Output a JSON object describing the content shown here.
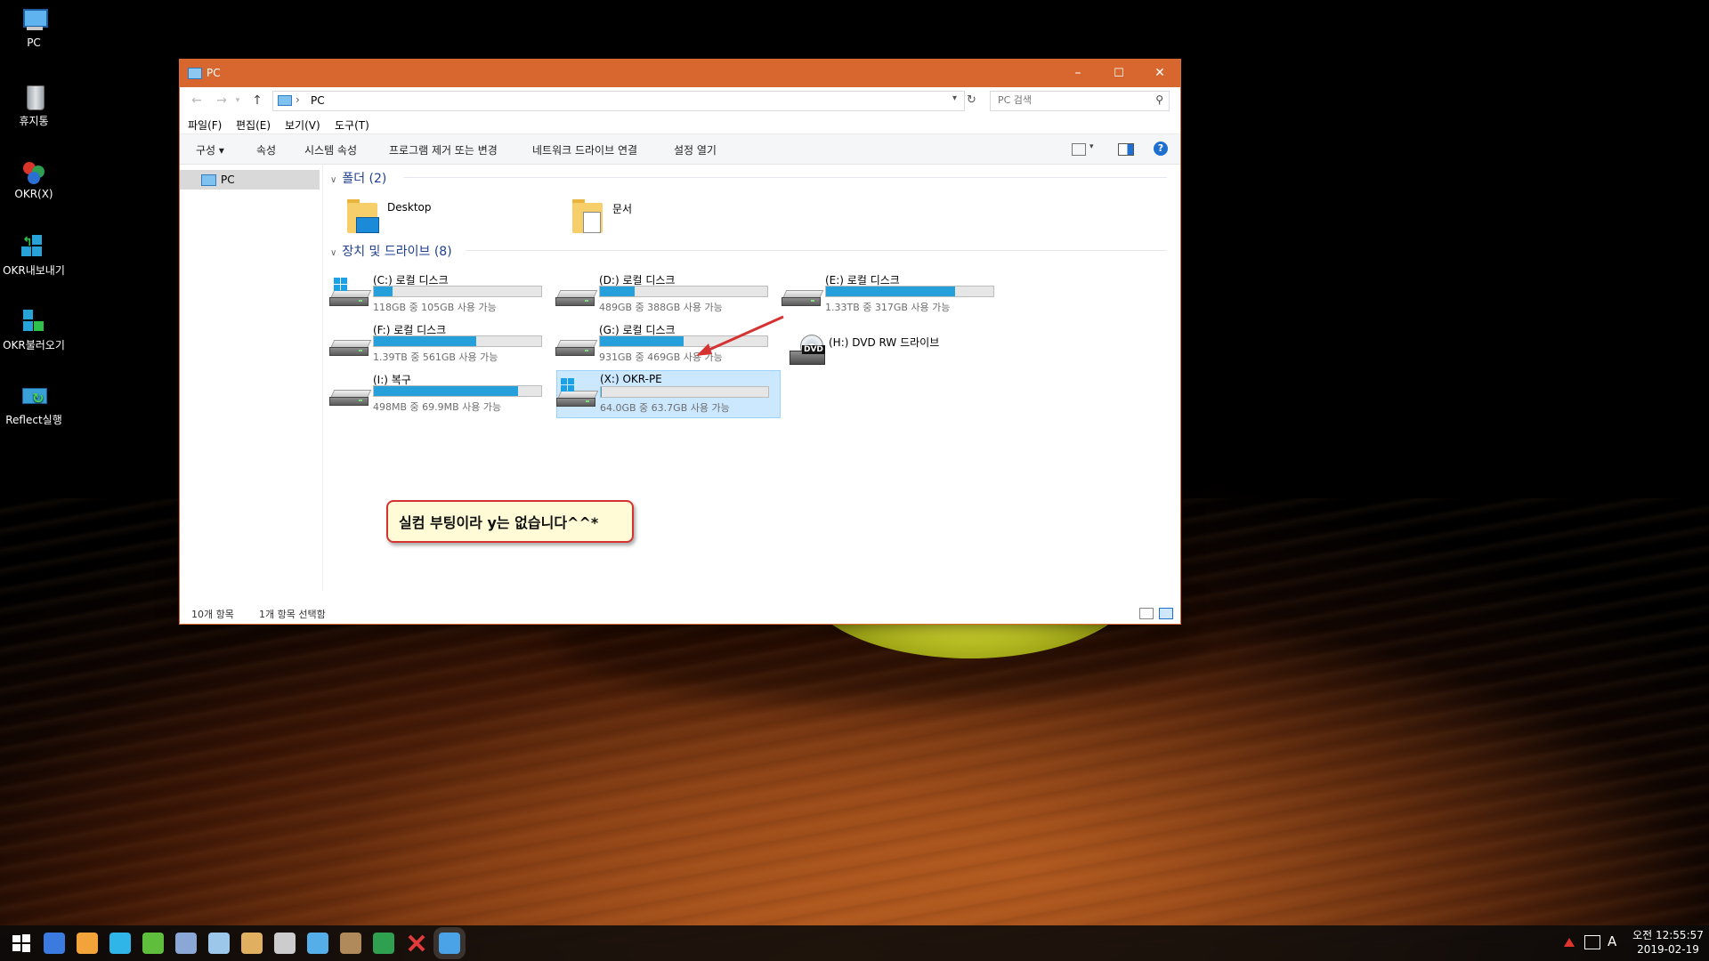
{
  "desktop": {
    "icons": [
      {
        "label": "PC",
        "icon": "pc-icon"
      },
      {
        "label": "휴지통",
        "icon": "recycle-bin-icon"
      },
      {
        "label": "OKR(X)",
        "icon": "okr-app-icon"
      },
      {
        "label": "OKR내보내기",
        "icon": "okr-export-icon"
      },
      {
        "label": "OKR불러오기",
        "icon": "okr-import-icon"
      },
      {
        "label": "Reflect실행",
        "icon": "reflect-icon"
      }
    ]
  },
  "window": {
    "title": "PC",
    "controls": {
      "minimize": "–",
      "maximize": "☐",
      "close": "✕"
    },
    "address": {
      "crumb": "PC",
      "separator": "›"
    },
    "search": {
      "placeholder": "PC 검색"
    },
    "menu": [
      "파일(F)",
      "편집(E)",
      "보기(V)",
      "도구(T)"
    ],
    "commands": [
      "구성 ▾",
      "속성",
      "시스템 속성",
      "프로그램 제거 또는 변경",
      "네트워크 드라이브 연결",
      "설정 열기"
    ],
    "help": "?",
    "nav": {
      "selected": "PC"
    },
    "groups": {
      "folders": {
        "title": "폴더 (2)",
        "items": [
          "Desktop",
          "문서"
        ]
      },
      "drives": {
        "title": "장치 및 드라이브 (8)"
      }
    },
    "drives": [
      {
        "name": "(C:) 로컬 디스크",
        "free": "118GB 중 105GB 사용 가능",
        "used": 0.11,
        "windows": true,
        "selected": false
      },
      {
        "name": "(D:) 로컬 디스크",
        "free": "489GB 중 388GB 사용 가능",
        "used": 0.21,
        "windows": false,
        "selected": false
      },
      {
        "name": "(E:) 로컬 디스크",
        "free": "1.33TB 중 317GB 사용 가능",
        "used": 0.77,
        "windows": false,
        "selected": false
      },
      {
        "name": "(F:) 로컬 디스크",
        "free": "1.39TB 중 561GB 사용 가능",
        "used": 0.61,
        "windows": false,
        "selected": false
      },
      {
        "name": "(G:) 로컬 디스크",
        "free": "931GB 중 469GB 사용 가능",
        "used": 0.5,
        "windows": false,
        "selected": false
      },
      {
        "name": "(I:) 복구",
        "free": "498MB 중 69.9MB 사용 가능",
        "used": 0.86,
        "windows": false,
        "selected": false
      },
      {
        "name": "(X:) OKR-PE",
        "free": "64.0GB 중 63.7GB 사용 가능",
        "used": 0.005,
        "windows": true,
        "selected": true
      }
    ],
    "dvd": {
      "name": "(H:) DVD RW 드라이브",
      "badge": "DVD"
    },
    "status": {
      "count": "10개 항목",
      "selected": "1개 항목 선택함"
    }
  },
  "annotation": {
    "text": "실컴 부팅이라 y는 없습니다^^*",
    "color": "#d63232"
  },
  "taskbar": {
    "icons": [
      "start-icon",
      "browser-icon",
      "paint-icon",
      "editor-icon",
      "network-icon",
      "users-icon",
      "notepad-icon",
      "archive-icon",
      "tools-icon",
      "laptop-icon",
      "puzzle-icon",
      "terminal-icon",
      "close-red-icon",
      "explorer-icon"
    ],
    "tray": {
      "ime": "A",
      "time": "오전 12:55:57",
      "date": "2019-02-19"
    }
  }
}
